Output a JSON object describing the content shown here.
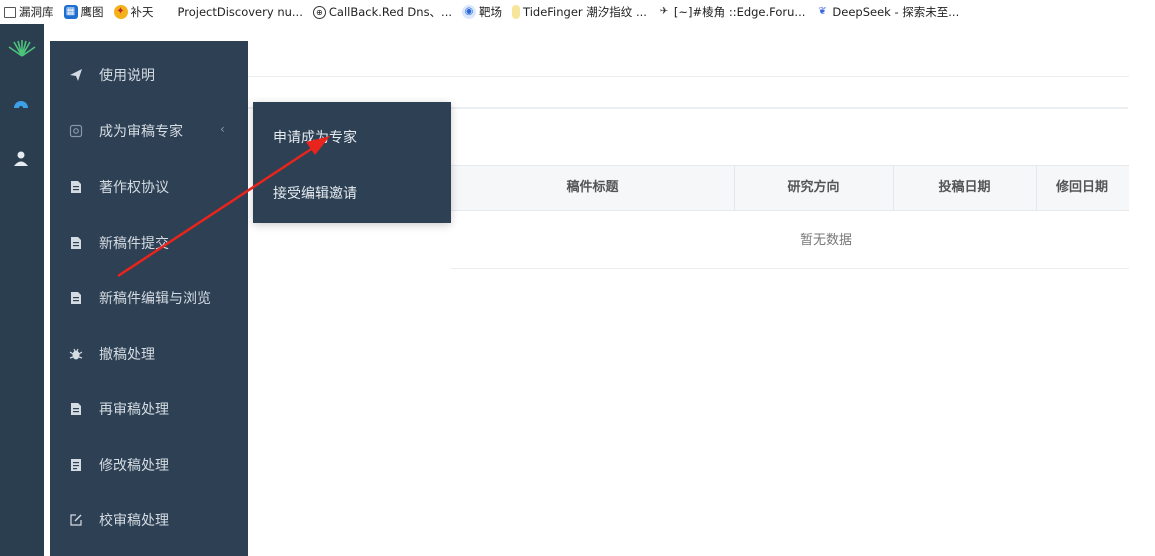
{
  "bookmarks": [
    {
      "label": "漏洞库",
      "icon": "folder-icon"
    },
    {
      "label": "鹰图",
      "icon": "hunter-icon"
    },
    {
      "label": "补天",
      "icon": "butian-icon"
    },
    {
      "label": "ProjectDiscovery nu...",
      "icon": "projectdiscovery-icon"
    },
    {
      "label": "CallBack.Red Dns、...",
      "icon": "globe-icon"
    },
    {
      "label": "靶场",
      "icon": "shield-icon"
    },
    {
      "label": "TideFinger 潮汐指纹 ...",
      "icon": "tidefinger-icon"
    },
    {
      "label": "[~]#棱角 ::Edge.Foru...",
      "icon": "edge-forum-icon"
    },
    {
      "label": "DeepSeek - 探索未至...",
      "icon": "deepseek-icon"
    }
  ],
  "sidebar": {
    "items": [
      {
        "label": "使用说明",
        "icon": "paper-plane-icon"
      },
      {
        "label": "成为审稿专家",
        "icon": "certificate-icon"
      },
      {
        "label": "著作权协议",
        "icon": "document-icon"
      },
      {
        "label": "新稿件提交",
        "icon": "document-icon"
      },
      {
        "label": "新稿件编辑与浏览",
        "icon": "document-icon"
      },
      {
        "label": "撤稿处理",
        "icon": "bug-icon"
      },
      {
        "label": "再审稿处理",
        "icon": "document-icon"
      },
      {
        "label": "修改稿处理",
        "icon": "form-icon"
      },
      {
        "label": "校审稿处理",
        "icon": "edit-icon"
      }
    ],
    "expand_arrow": "‹"
  },
  "submenu": {
    "items": [
      "申请成为专家",
      "接受编辑邀请"
    ]
  },
  "table": {
    "columns": [
      "稿件标题",
      "研究方向",
      "投稿日期",
      "修回日期"
    ],
    "empty_text": "暂无数据"
  },
  "colors": {
    "sidebar_bg": "#2d4054",
    "rail_bg": "#2b3e50",
    "annotation_arrow": "#e8241c"
  }
}
